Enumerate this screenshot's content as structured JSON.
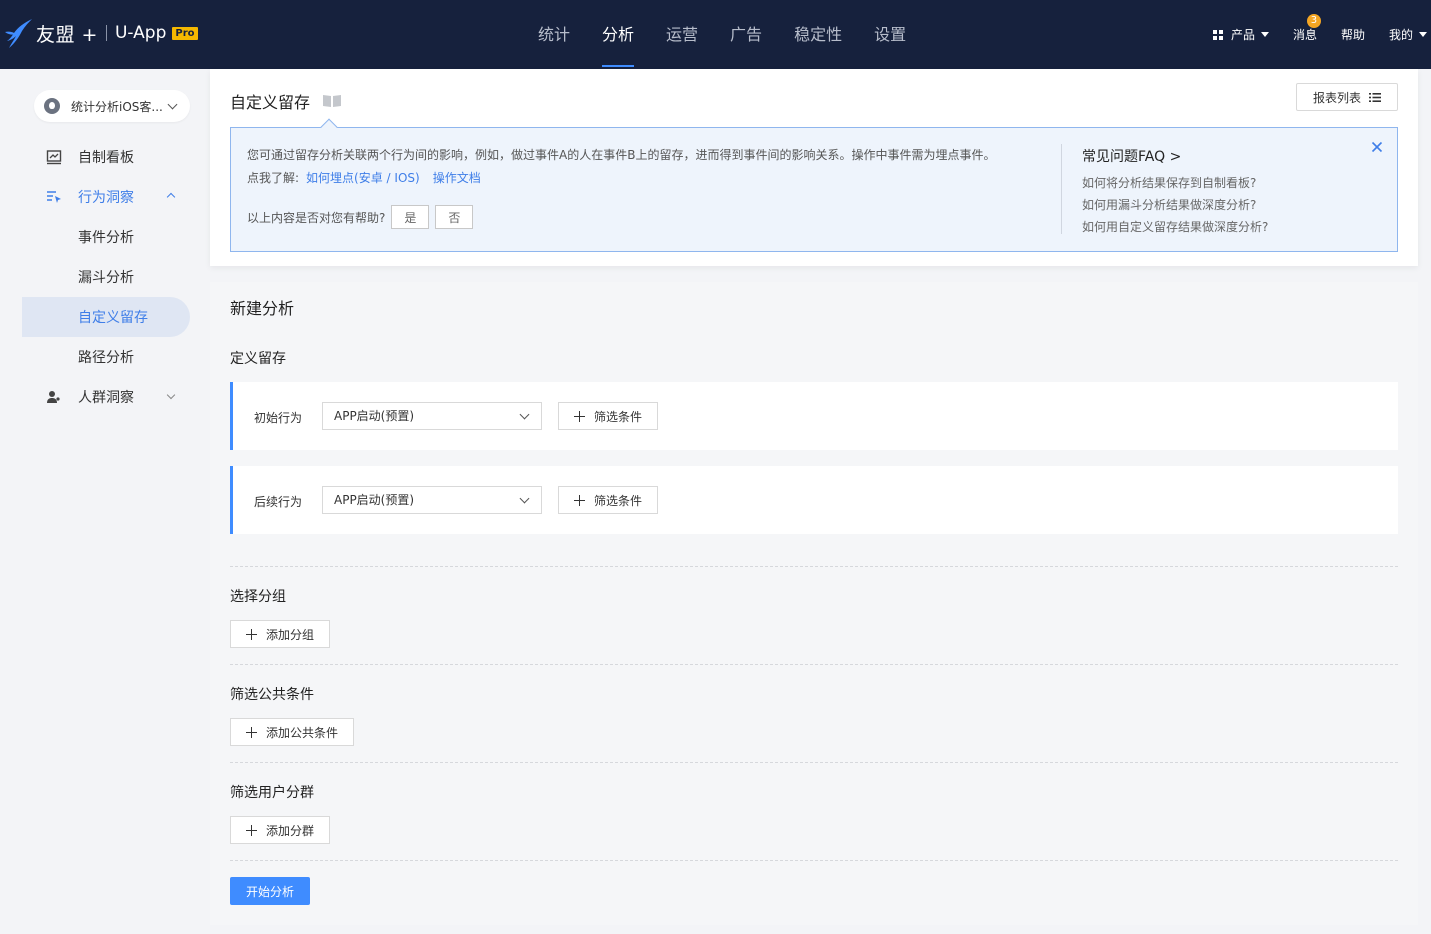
{
  "topbar": {
    "brand": "友盟 +",
    "app": "U-App",
    "pro": "Pro",
    "nav": [
      "统计",
      "分析",
      "运营",
      "广告",
      "稳定性",
      "设置"
    ],
    "active_nav": "分析",
    "product": "产品",
    "messages": "消息",
    "message_count": "3",
    "help": "帮助",
    "mine": "我的"
  },
  "sidebar": {
    "app_selector": "统计分析iOS客...",
    "menu": {
      "dashboard": "自制看板",
      "behavior": "行为洞察",
      "sub": [
        "事件分析",
        "漏斗分析",
        "自定义留存",
        "路径分析"
      ],
      "crowd": "人群洞察"
    }
  },
  "header": {
    "title": "自定义留存",
    "report_list": "报表列表"
  },
  "tip": {
    "text": "您可通过留存分析关联两个行为间的影响，例如，做过事件A的人在事件B上的留存，进而得到事件间的影响关系。操作中事件需为埋点事件。",
    "learn_prefix": "点我了解:",
    "link1": "如何埋点(安卓 / IOS)",
    "link2": "操作文档",
    "helpful_q": "以上内容是否对您有帮助?",
    "yes": "是",
    "no": "否",
    "faq_title": "常见问题FAQ >",
    "faq": [
      "如何将分析结果保存到自制看板?",
      "如何用漏斗分析结果做深度分析?",
      "如何用自定义留存结果做深度分析?"
    ]
  },
  "main": {
    "section_title": "新建分析",
    "define_title": "定义留存",
    "initial_label": "初始行为",
    "initial_value": "APP启动(预置)",
    "followup_label": "后续行为",
    "followup_value": "APP启动(预置)",
    "filter_label": "筛选条件",
    "group_title": "选择分组",
    "add_group": "添加分组",
    "common_title": "筛选公共条件",
    "add_common": "添加公共条件",
    "segment_title": "筛选用户分群",
    "add_segment": "添加分群",
    "start": "开始分析"
  }
}
